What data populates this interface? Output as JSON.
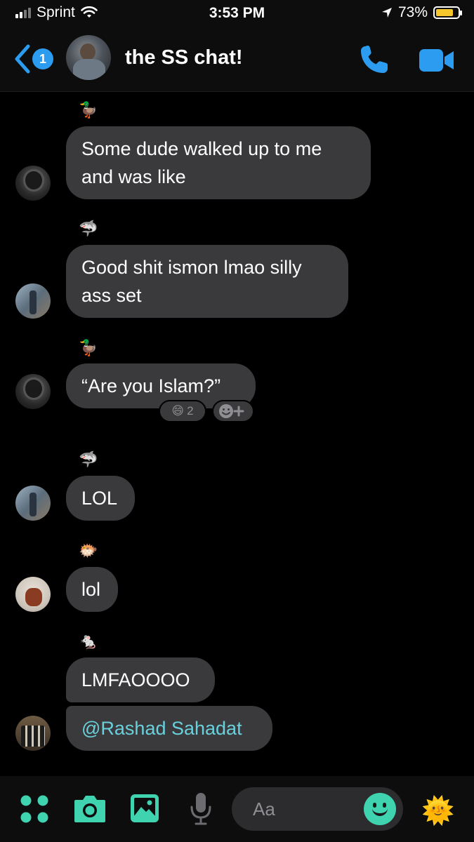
{
  "status_bar": {
    "carrier": "Sprint",
    "time": "3:53 PM",
    "battery_percent": "73%",
    "battery_level": 0.73,
    "battery_color": "#f5c72c"
  },
  "header": {
    "back_badge": "1",
    "title": "the SS chat!",
    "accent_color": "#2c9cf0"
  },
  "messages": [
    {
      "sender_emoji": "🦆",
      "text": "Some dude walked up to me and was like",
      "avatar": "avatar-1"
    },
    {
      "sender_emoji": "🦈",
      "text": "Good shit ismon lmao silly ass set",
      "avatar": "avatar-2"
    },
    {
      "sender_emoji": "🦆",
      "text": "“Are you Islam?”",
      "avatar": "avatar-1",
      "reactions": [
        {
          "emoji": "😄",
          "count": "2"
        }
      ]
    },
    {
      "sender_emoji": "🦈",
      "text": "LOL",
      "avatar": "avatar-2"
    },
    {
      "sender_emoji": "🐡",
      "text": "lol",
      "avatar": "avatar-3"
    },
    {
      "sender_emoji": "🐁",
      "text": "LMFAOOOO",
      "avatar": "avatar-4"
    },
    {
      "sender_emoji": "",
      "text": "@Rashad Sahadat",
      "avatar": "avatar-4",
      "is_mention": true
    }
  ],
  "composer": {
    "placeholder": "Aa",
    "sun_emoji": "🌞"
  }
}
